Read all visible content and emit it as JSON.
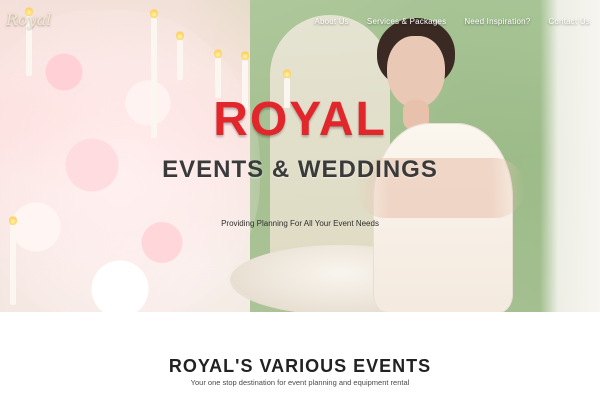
{
  "brand": {
    "logo_text": "Royal"
  },
  "nav": {
    "items": [
      {
        "label": "About Us"
      },
      {
        "label": "Services & Packages"
      },
      {
        "label": "Need Inspiration?"
      },
      {
        "label": "Contact Us"
      }
    ]
  },
  "hero": {
    "title": "ROYAL",
    "subtitle": "EVENTS & WEDDINGS",
    "tagline": "Providing Planning For All Your Event Needs"
  },
  "section": {
    "title": "ROYAL'S VARIOUS EVENTS",
    "subtitle": "Your one stop destination for event planning and equipment rental"
  },
  "colors": {
    "accent_red": "#e1262c",
    "subtitle_gray": "#3a3a3a",
    "nav_text": "#ffffff"
  }
}
